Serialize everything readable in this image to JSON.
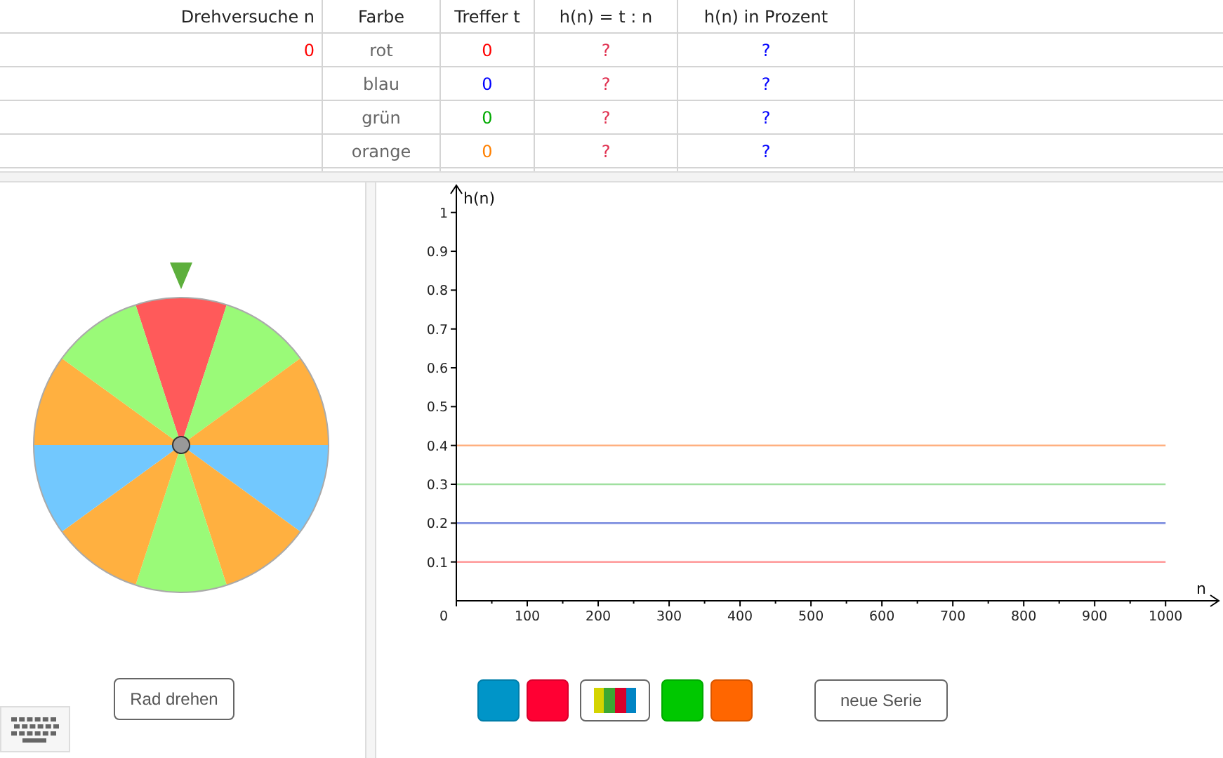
{
  "table": {
    "columns": [
      "Drehversuche n",
      "Farbe",
      "Treffer t",
      "h(n) = t : n",
      "h(n) in Prozent"
    ],
    "rows": [
      {
        "n": "0",
        "farbe": "rot",
        "treffer": "0",
        "h": "?",
        "prozent": "?",
        "color": "#ff0000"
      },
      {
        "farbe": "blau",
        "treffer": "0",
        "h": "?",
        "prozent": "?",
        "color": "#0000ff"
      },
      {
        "farbe": "grün",
        "treffer": "0",
        "h": "?",
        "prozent": "?",
        "color": "#00aa00"
      },
      {
        "farbe": "orange",
        "treffer": "0",
        "h": "?",
        "prozent": "?",
        "color": "#ff8000"
      }
    ]
  },
  "wheel": {
    "sectors": [
      {
        "color": "#ff5a5a"
      },
      {
        "color": "#9afa78"
      },
      {
        "color": "#ffb040"
      },
      {
        "color": "#72c8fe"
      },
      {
        "color": "#ffb040"
      },
      {
        "color": "#9afa78"
      },
      {
        "color": "#ffb040"
      },
      {
        "color": "#72c8fe"
      },
      {
        "color": "#ffb040"
      },
      {
        "color": "#9afa78"
      }
    ],
    "button": "Rad drehen"
  },
  "graph": {
    "ylabel": "h(n)",
    "xlabel": "n",
    "x_origin": "0",
    "chart_data": {
      "type": "line",
      "x": [
        0,
        1000
      ],
      "xlim": [
        0,
        1075
      ],
      "ylim": [
        0,
        1.07
      ],
      "yticks": [
        0.1,
        0.2,
        0.3,
        0.4,
        0.5,
        0.6,
        0.7,
        0.8,
        0.9,
        1
      ],
      "xticks": [
        100,
        200,
        300,
        400,
        500,
        600,
        700,
        800,
        900,
        1000
      ],
      "series": [
        {
          "color": "#ffb080",
          "values": [
            0.4,
            0.4
          ]
        },
        {
          "color": "#a0e0a0",
          "values": [
            0.3,
            0.3
          ]
        },
        {
          "color": "#8090e0",
          "values": [
            0.2,
            0.2
          ]
        },
        {
          "color": "#ffa0a0",
          "values": [
            0.1,
            0.1
          ]
        }
      ]
    }
  },
  "color_buttons": [
    {
      "kind": "swatch",
      "color": "#0095c8"
    },
    {
      "kind": "swatch",
      "color": "#ff0033"
    },
    {
      "kind": "all"
    },
    {
      "kind": "swatch",
      "color": "#00c800"
    },
    {
      "kind": "swatch",
      "color": "#ff6600"
    }
  ],
  "series_button": "neue Serie"
}
